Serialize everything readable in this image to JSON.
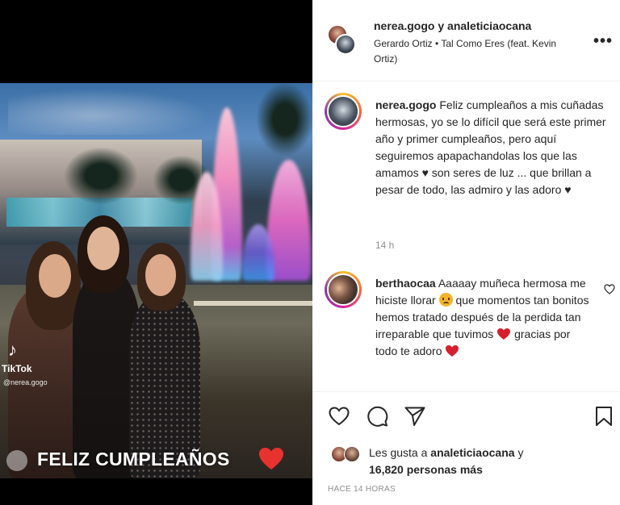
{
  "video": {
    "watermark_brand": "TikTok",
    "watermark_user": "@nerea.gogo",
    "caption": "FELIZ CUMPLEAÑOS"
  },
  "header": {
    "user1": "nerea.gogo",
    "joiner": "y",
    "user2": "analeticiaocana",
    "audio": "Gerardo Ortiz • Tal Como Eres (feat. Kevin Ortiz)",
    "more_icon": "more-horizontal-icon"
  },
  "post_caption": {
    "username": "nerea.gogo",
    "text": "Feliz cumpleaños a mis cuñadas hermosas, yo se lo difícil que será este primer año y primer cumpleaños, pero aquí seguiremos apapachandolas los que las amamos ♥ son seres de luz ... que brillan a pesar de todo, las admiro y las adoro ♥",
    "time": "14 h"
  },
  "comment": {
    "username": "berthaocaa",
    "text_part1": "Aaaaay muñeca hermosa me hiciste llorar",
    "text_part2": "que momentos tan bonitos hemos tratado después de la perdida tan irreparable que tuvimos",
    "text_part3": "gracias por todo te adoro",
    "like_icon": "heart-outline-icon"
  },
  "actions": {
    "like_icon": "heart-icon",
    "comment_icon": "comment-icon",
    "share_icon": "send-icon",
    "save_icon": "bookmark-icon"
  },
  "likes": {
    "prefix": "Les gusta a",
    "user": "analeticiaocana",
    "joiner": "y",
    "count": "16,820 personas más"
  },
  "timestamp": "HACE 14 HORAS",
  "colors": {
    "text": "#262626",
    "muted": "#8e8e8e",
    "heart_red": "#e0245e",
    "border": "#efefef"
  }
}
